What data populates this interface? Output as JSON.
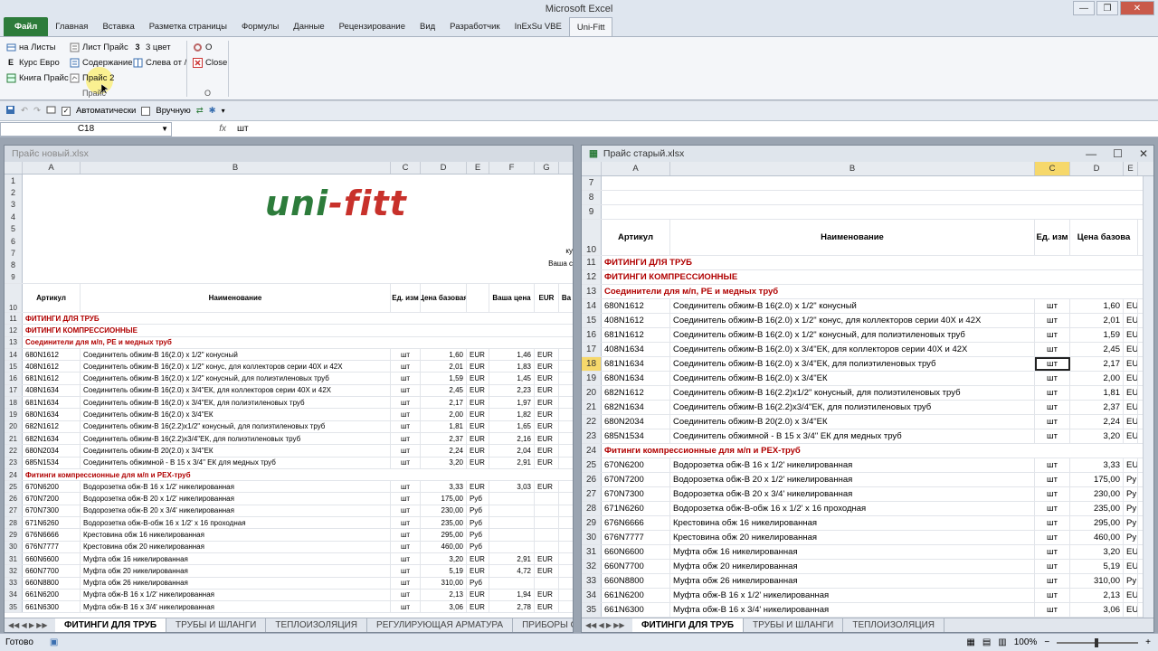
{
  "app": {
    "title": "Microsoft Excel",
    "controls": {
      "minimize": "—",
      "restore": "❐",
      "close": "✕"
    }
  },
  "ribbon_tabs": [
    "Файл",
    "Главная",
    "Вставка",
    "Разметка страницы",
    "Формулы",
    "Данные",
    "Рецензирование",
    "Вид",
    "Разработчик",
    "InExSu VBE",
    "Uni-Fitt"
  ],
  "ribbon": {
    "buttons": {
      "na_listy": "на Листы",
      "list_prais": "Лист Прайс",
      "tri_tsvet": "3 цвет",
      "o": "О",
      "kurs_evro": "Курс Евро",
      "soderzhanie": "Содержание",
      "sleva_ot": "Слева от /",
      "close": "Close",
      "kniga_prais": "Книга Прайс",
      "prais_2": "Прайс 2"
    },
    "icons": {
      "tri_tsvet": "3",
      "kurs_evro": "E"
    },
    "groups": {
      "prais": "Прайс",
      "o": "О"
    }
  },
  "qat": {
    "auto_label": "Автоматически",
    "manual_label": "Вручную",
    "auto_checked": "✓"
  },
  "formula_bar": {
    "name_box": "C18",
    "fx": "fx",
    "value": "шт"
  },
  "left_pane": {
    "title": "Прайс новый.xlsx",
    "columns": [
      "A",
      "B",
      "C",
      "D",
      "E",
      "F",
      "G"
    ],
    "logo_a": "uni",
    "logo_b": "-fitt",
    "top_right_1": "ку",
    "top_right_2": "Ваша с",
    "header": {
      "artikul": "Артикул",
      "name": "Наименование",
      "unit": "Ед. изм",
      "price": "Цена базовая",
      "your_price": "Ваша цена",
      "eur": "EUR",
      "va": "Ва"
    },
    "sections": {
      "r11": "ФИТИНГИ ДЛЯ ТРУБ",
      "r12": "ФИТИНГИ КОМПРЕССИОННЫЕ",
      "r13": "Соединители для м/п, PE и медных труб",
      "r24": "Фитинги компрессионные для м/п и PEX-труб"
    },
    "rows": [
      {
        "n": "14",
        "a": "680N1612",
        "b": "Соединитель обжим-В 16(2.0)  х 1/2\" конусный",
        "c": "шт",
        "d": "1,60",
        "e": "EUR",
        "f": "1,46",
        "g": "EUR"
      },
      {
        "n": "15",
        "a": "408N1612",
        "b": "Соединитель обжим-В 16(2.0) х 1/2\" конус, для коллекторов серии 40Х и 42Х",
        "c": "шт",
        "d": "2,01",
        "e": "EUR",
        "f": "1,83",
        "g": "EUR"
      },
      {
        "n": "16",
        "a": "681N1612",
        "b": "Соединитель обжим-В 16(2.0) х 1/2\" конусный, для полиэтиленовых труб",
        "c": "шт",
        "d": "1,59",
        "e": "EUR",
        "f": "1,45",
        "g": "EUR"
      },
      {
        "n": "17",
        "a": "408N1634",
        "b": "Соединитель обжим-В 16(2.0) х 3/4\"ЕК, для коллекторов серии 40Х и 42Х",
        "c": "шт",
        "d": "2,45",
        "e": "EUR",
        "f": "2,23",
        "g": "EUR"
      },
      {
        "n": "18",
        "a": "681N1634",
        "b": "Соединитель обжим-В 16(2.0) х 3/4\"ЕК, для полиэтиленовых труб",
        "c": "шт",
        "d": "2,17",
        "e": "EUR",
        "f": "1,97",
        "g": "EUR"
      },
      {
        "n": "19",
        "a": "680N1634",
        "b": "Соединитель обжим-В 16(2.0) х 3/4\"ЕК",
        "c": "шт",
        "d": "2,00",
        "e": "EUR",
        "f": "1,82",
        "g": "EUR"
      },
      {
        "n": "20",
        "a": "682N1612",
        "b": "Соединитель обжим-В 16(2.2)х1/2\" конусный, для полиэтиленовых труб",
        "c": "шт",
        "d": "1,81",
        "e": "EUR",
        "f": "1,65",
        "g": "EUR"
      },
      {
        "n": "21",
        "a": "682N1634",
        "b": "Соединитель обжим-В 16(2.2)х3/4\"ЕК, для полиэтиленовых труб",
        "c": "шт",
        "d": "2,37",
        "e": "EUR",
        "f": "2,16",
        "g": "EUR"
      },
      {
        "n": "22",
        "a": "680N2034",
        "b": "Соединитель обжим-В 20(2.0) х 3/4\"ЕК",
        "c": "шт",
        "d": "2,24",
        "e": "EUR",
        "f": "2,04",
        "g": "EUR"
      },
      {
        "n": "23",
        "a": "685N1534",
        "b": "Соединитель обжимной - В 15 х 3/4\" ЕК для медных труб",
        "c": "шт",
        "d": "3,20",
        "e": "EUR",
        "f": "2,91",
        "g": "EUR"
      }
    ],
    "rows2": [
      {
        "n": "25",
        "a": "670N6200",
        "b": "Водорозетка обж-В 16 х 1/2' никелированная",
        "c": "шт",
        "d": "3,33",
        "e": "EUR",
        "f": "3,03",
        "g": "EUR"
      },
      {
        "n": "26",
        "a": "670N7200",
        "b": "Водорозетка обж-В 20 х 1/2' никелированная",
        "c": "шт",
        "d": "175,00",
        "e": "Руб",
        "f": "",
        "g": ""
      },
      {
        "n": "27",
        "a": "670N7300",
        "b": "Водорозетка обж-В 20 х 3/4' никелированная",
        "c": "шт",
        "d": "230,00",
        "e": "Руб",
        "f": "",
        "g": ""
      },
      {
        "n": "28",
        "a": "671N6260",
        "b": "Водорозетка обж-В-обж 16 х 1/2' х 16 проходная",
        "c": "шт",
        "d": "235,00",
        "e": "Руб",
        "f": "",
        "g": ""
      },
      {
        "n": "29",
        "a": "676N6666",
        "b": "Крестовина обж 16 никелированная",
        "c": "шт",
        "d": "295,00",
        "e": "Руб",
        "f": "",
        "g": ""
      },
      {
        "n": "30",
        "a": "676N7777",
        "b": "Крестовина обж 20 никелированная",
        "c": "шт",
        "d": "460,00",
        "e": "Руб",
        "f": "",
        "g": ""
      },
      {
        "n": "31",
        "a": "660N6600",
        "b": "Муфта обж 16 никелированная",
        "c": "шт",
        "d": "3,20",
        "e": "EUR",
        "f": "2,91",
        "g": "EUR"
      },
      {
        "n": "32",
        "a": "660N7700",
        "b": "Муфта обж 20 никелированная",
        "c": "шт",
        "d": "5,19",
        "e": "EUR",
        "f": "4,72",
        "g": "EUR"
      },
      {
        "n": "33",
        "a": "660N8800",
        "b": "Муфта обж 26 никелированная",
        "c": "шт",
        "d": "310,00",
        "e": "Руб",
        "f": "",
        "g": ""
      },
      {
        "n": "34",
        "a": "661N6200",
        "b": "Муфта обж-В 16 х 1/2' никелированная",
        "c": "шт",
        "d": "2,13",
        "e": "EUR",
        "f": "1,94",
        "g": "EUR"
      },
      {
        "n": "35",
        "a": "661N6300",
        "b": "Муфта обж-В 16 х 3/4' никелированная",
        "c": "шт",
        "d": "3,06",
        "e": "EUR",
        "f": "2,78",
        "g": "EUR"
      }
    ],
    "sheet_tabs": [
      "ФИТИНГИ ДЛЯ ТРУБ",
      "ТРУБЫ И ШЛАНГИ",
      "ТЕПЛОИЗОЛЯЦИЯ",
      "РЕГУЛИРУЮЩАЯ АРМАТУРА",
      "ПРИБОРЫ ОТО"
    ]
  },
  "right_pane": {
    "title": "Прайс старый.xlsx",
    "columns": [
      "A",
      "B",
      "C",
      "D",
      "E"
    ],
    "header": {
      "artikul": "Артикул",
      "name": "Наименование",
      "unit": "Ед. изм",
      "price": "Цена базова"
    },
    "sections": {
      "r11": "ФИТИНГИ ДЛЯ ТРУБ",
      "r12": "ФИТИНГИ КОМПРЕССИОННЫЕ",
      "r13": "Соединители для м/п, PE и медных труб",
      "r24": "Фитинги компрессионные для м/п и PEX-труб"
    },
    "rows": [
      {
        "n": "14",
        "a": "680N1612",
        "b": "Соединитель обжим-В 16(2.0)  х 1/2\" конусный",
        "c": "шт",
        "d": "1,60",
        "e": "EU"
      },
      {
        "n": "15",
        "a": "408N1612",
        "b": "Соединитель обжим-В 16(2.0) х 1/2\" конус, для коллекторов серии 40Х и 42Х",
        "c": "шт",
        "d": "2,01",
        "e": "EU"
      },
      {
        "n": "16",
        "a": "681N1612",
        "b": "Соединитель обжим-В 16(2.0) х 1/2\" конусный, для полиэтиленовых труб",
        "c": "шт",
        "d": "1,59",
        "e": "EU"
      },
      {
        "n": "17",
        "a": "408N1634",
        "b": "Соединитель обжим-В 16(2.0) х 3/4\"ЕК, для коллекторов серии 40Х и 42Х",
        "c": "шт",
        "d": "2,45",
        "e": "EU"
      },
      {
        "n": "18",
        "a": "681N1634",
        "b": "Соединитель обжим-В 16(2.0) х 3/4\"ЕК, для полиэтиленовых труб",
        "c": "шт",
        "d": "2,17",
        "e": "EU"
      },
      {
        "n": "19",
        "a": "680N1634",
        "b": "Соединитель обжим-В 16(2.0) х 3/4\"ЕК",
        "c": "шт",
        "d": "2,00",
        "e": "EU"
      },
      {
        "n": "20",
        "a": "682N1612",
        "b": "Соединитель обжим-В 16(2.2)х1/2\" конусный, для полиэтиленовых труб",
        "c": "шт",
        "d": "1,81",
        "e": "EU"
      },
      {
        "n": "21",
        "a": "682N1634",
        "b": "Соединитель обжим-В 16(2.2)х3/4\"ЕК, для полиэтиленовых труб",
        "c": "шт",
        "d": "2,37",
        "e": "EU"
      },
      {
        "n": "22",
        "a": "680N2034",
        "b": "Соединитель обжим-В 20(2.0) х 3/4\"ЕК",
        "c": "шт",
        "d": "2,24",
        "e": "EU"
      },
      {
        "n": "23",
        "a": "685N1534",
        "b": "Соединитель обжимной - В 15 х 3/4\" ЕК для медных труб",
        "c": "шт",
        "d": "3,20",
        "e": "EU"
      }
    ],
    "rows2": [
      {
        "n": "25",
        "a": "670N6200",
        "b": "Водорозетка обж-В 16 х 1/2' никелированная",
        "c": "шт",
        "d": "3,33",
        "e": "EU"
      },
      {
        "n": "26",
        "a": "670N7200",
        "b": "Водорозетка обж-В 20 х 1/2' никелированная",
        "c": "шт",
        "d": "175,00",
        "e": "Ру"
      },
      {
        "n": "27",
        "a": "670N7300",
        "b": "Водорозетка обж-В 20 х 3/4' никелированная",
        "c": "шт",
        "d": "230,00",
        "e": "Ру"
      },
      {
        "n": "28",
        "a": "671N6260",
        "b": "Водорозетка обж-В-обж 16 х 1/2' х 16 проходная",
        "c": "шт",
        "d": "235,00",
        "e": "Ру"
      },
      {
        "n": "29",
        "a": "676N6666",
        "b": "Крестовина обж 16 никелированная",
        "c": "шт",
        "d": "295,00",
        "e": "Ру"
      },
      {
        "n": "30",
        "a": "676N7777",
        "b": "Крестовина обж 20 никелированная",
        "c": "шт",
        "d": "460,00",
        "e": "Ру"
      },
      {
        "n": "31",
        "a": "660N6600",
        "b": "Муфта обж 16 никелированная",
        "c": "шт",
        "d": "3,20",
        "e": "EU"
      },
      {
        "n": "32",
        "a": "660N7700",
        "b": "Муфта обж 20 никелированная",
        "c": "шт",
        "d": "5,19",
        "e": "EU"
      },
      {
        "n": "33",
        "a": "660N8800",
        "b": "Муфта обж 26 никелированная",
        "c": "шт",
        "d": "310,00",
        "e": "Ру"
      },
      {
        "n": "34",
        "a": "661N6200",
        "b": "Муфта обж-В 16 х 1/2' никелированная",
        "c": "шт",
        "d": "2,13",
        "e": "EU"
      },
      {
        "n": "35",
        "a": "661N6300",
        "b": "Муфта обж-В 16 х 3/4' никелированная",
        "c": "шт",
        "d": "3,06",
        "e": "EU"
      }
    ],
    "sheet_tabs": [
      "ФИТИНГИ ДЛЯ ТРУБ",
      "ТРУБЫ И ШЛАНГИ",
      "ТЕПЛОИЗОЛЯЦИЯ"
    ]
  },
  "status": {
    "ready": "Готово",
    "zoom": "100%"
  },
  "colors": {
    "file_tab": "#2d7c3b",
    "section_red": "#b00000",
    "selection": "#f6d86b"
  }
}
